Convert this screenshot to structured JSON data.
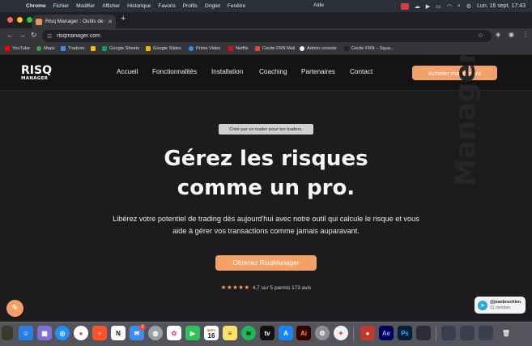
{
  "menubar": {
    "app": "Chrome",
    "items": [
      "Fichier",
      "Modifier",
      "Afficher",
      "Historique",
      "Favoris",
      "Profils",
      "Onglet",
      "Fenêtre"
    ],
    "help": "Aide",
    "datetime": "Lun. 16 sept.  17:43"
  },
  "browser": {
    "tab_title": "Risq Manager : Outils de trad",
    "url": "risqmanager.com",
    "bookmarks": [
      "YouTube",
      "Maps",
      "Traduire",
      "Google Sheets",
      "Google Slides",
      "Prime Video",
      "Netflix",
      "Cecile FRN Mail",
      "Admin console",
      "Cecile FRN – Squa..."
    ]
  },
  "site": {
    "logo_top": "RISQ",
    "logo_bottom": "MANAGER",
    "nav": [
      "Accueil",
      "Fonctionnalités",
      "Installation",
      "Coaching",
      "Partenaires",
      "Contact"
    ],
    "cta_top": "Acheter maintenant",
    "watermark": "Manager",
    "badge": "Créé par un trader pour les traders.",
    "headline_line1": "Gérez les risques",
    "headline_line2": "comme un pro.",
    "lead_line1": "Libérez votre potentiel de trading dès aujourd'hui avec notre outil qui calcule le risque et vous",
    "lead_line2": "aide à gérer vos transactions comme jamais auparavant.",
    "cta_main": "Obtenez RisqManager",
    "stars": "★★★★★",
    "rating_text": "4,7 sur 5 parmis 173 avis"
  },
  "telegram": {
    "handle": "@jeanbruchlen",
    "members": "31 member"
  },
  "dock": {
    "calendar_month": "SEPT.",
    "calendar_day": "16",
    "mail_badge": "2"
  },
  "colors": {
    "accent": "#f4a069",
    "background": "#1c1c1e",
    "nav_background": "#141414"
  }
}
